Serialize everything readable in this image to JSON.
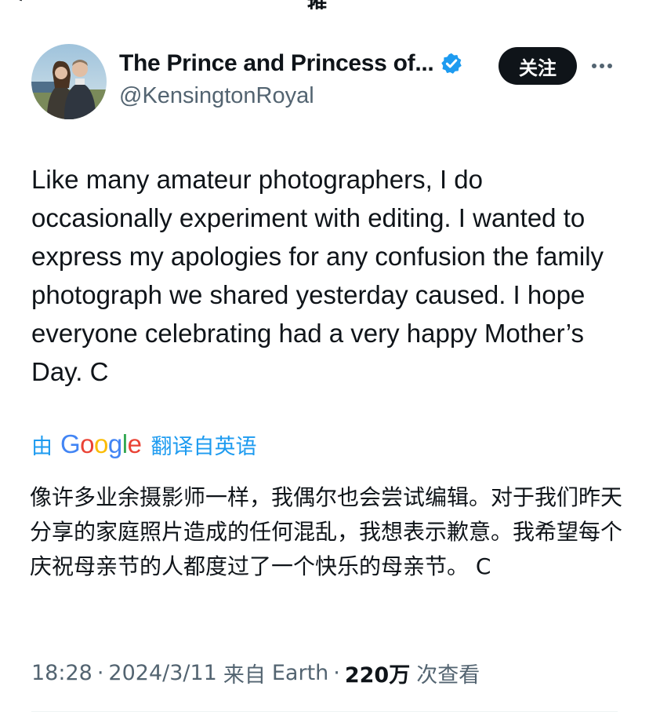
{
  "top_fragment": {
    "text": "推"
  },
  "author": {
    "display_name": "The Prince and Princess of...",
    "handle": "@KensingtonRoyal",
    "verified": true,
    "verified_color": "#1d9bf0"
  },
  "follow_button": {
    "label": "关注"
  },
  "more_icon": "more-horizontal-icon",
  "tweet": {
    "text": "Like many amateur photographers, I do occasionally experiment with editing. I wanted to express my apologies for any confusion the family photograph we shared yesterday caused. I hope everyone celebrating had a very happy Mother’s Day. C"
  },
  "translation": {
    "prefix": "由",
    "provider": "Google",
    "suffix": "翻译自英语",
    "text": "像许多业余摄影师一样，我偶尔也会尝试编辑。对于我们昨天分享的家庭照片造成的任何混乱，我想表示歉意。我希望每个庆祝母亲节的人都度过了一个快乐的母亲节。 C"
  },
  "meta": {
    "time": "18:28",
    "date": "2024/3/11",
    "source_prefix": "来自",
    "source": "Earth",
    "views_count": "220万",
    "views_label": "次查看"
  },
  "colors": {
    "text_primary": "#0f1419",
    "text_secondary": "#536471",
    "link_blue": "#1d9bf0",
    "follow_bg": "#0f1419"
  }
}
